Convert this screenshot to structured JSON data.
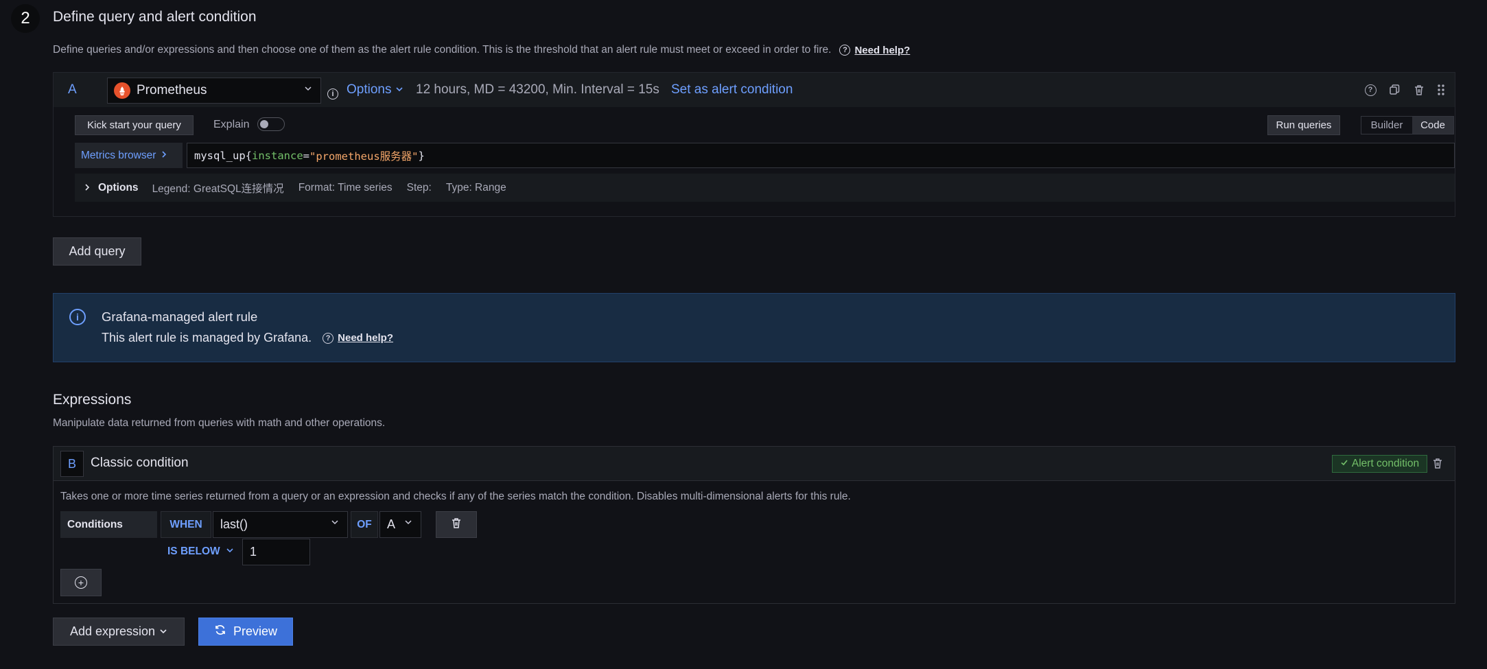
{
  "step": {
    "number": "2",
    "title": "Define query and alert condition",
    "description": "Define queries and/or expressions and then choose one of them as the alert rule condition. This is the threshold that an alert rule must meet or exceed in order to fire.",
    "help_label": "Need help?"
  },
  "query": {
    "ref": "A",
    "datasource": "Prometheus",
    "options_label": "Options",
    "options_meta": "12 hours, MD = 43200, Min. Interval = 15s",
    "set_alert_label": "Set as alert condition",
    "kick_start_label": "Kick start your query",
    "explain_label": "Explain",
    "explain_on": false,
    "run_label": "Run queries",
    "mode_builder": "Builder",
    "mode_code": "Code",
    "metrics_browser_label": "Metrics browser",
    "expr": {
      "metric": "mysql_up",
      "open": "{",
      "label_key": "instance",
      "eq": "=",
      "label_value": "\"prometheus服务器\"",
      "close": "}"
    },
    "options_row": {
      "label": "Options",
      "legend": "Legend: GreatSQL连接情况",
      "format": "Format: Time series",
      "step": "Step:",
      "type": "Type: Range"
    }
  },
  "add_query_label": "Add query",
  "info": {
    "title": "Grafana-managed alert rule",
    "body": "This alert rule is managed by Grafana.",
    "help_label": "Need help?"
  },
  "expressions": {
    "title": "Expressions",
    "description": "Manipulate data returned from queries with math and other operations.",
    "items": [
      {
        "ref": "B",
        "title": "Classic condition",
        "alert_badge": "Alert condition",
        "description": "Takes one or more time series returned from a query or an expression and checks if any of the series match the condition. Disables multi-dimensional alerts for this rule.",
        "conditions_label": "Conditions",
        "when_label": "WHEN",
        "reducer": "last()",
        "of_label": "OF",
        "query_ref": "A",
        "evaluator": "IS BELOW",
        "threshold": "1"
      }
    ]
  },
  "add_expression_label": "Add expression",
  "preview_label": "Preview",
  "colors": {
    "accent": "#6e9fff",
    "primary_button": "#3d71d9",
    "success": "#73bf69",
    "prometheus": "#e6522c"
  }
}
